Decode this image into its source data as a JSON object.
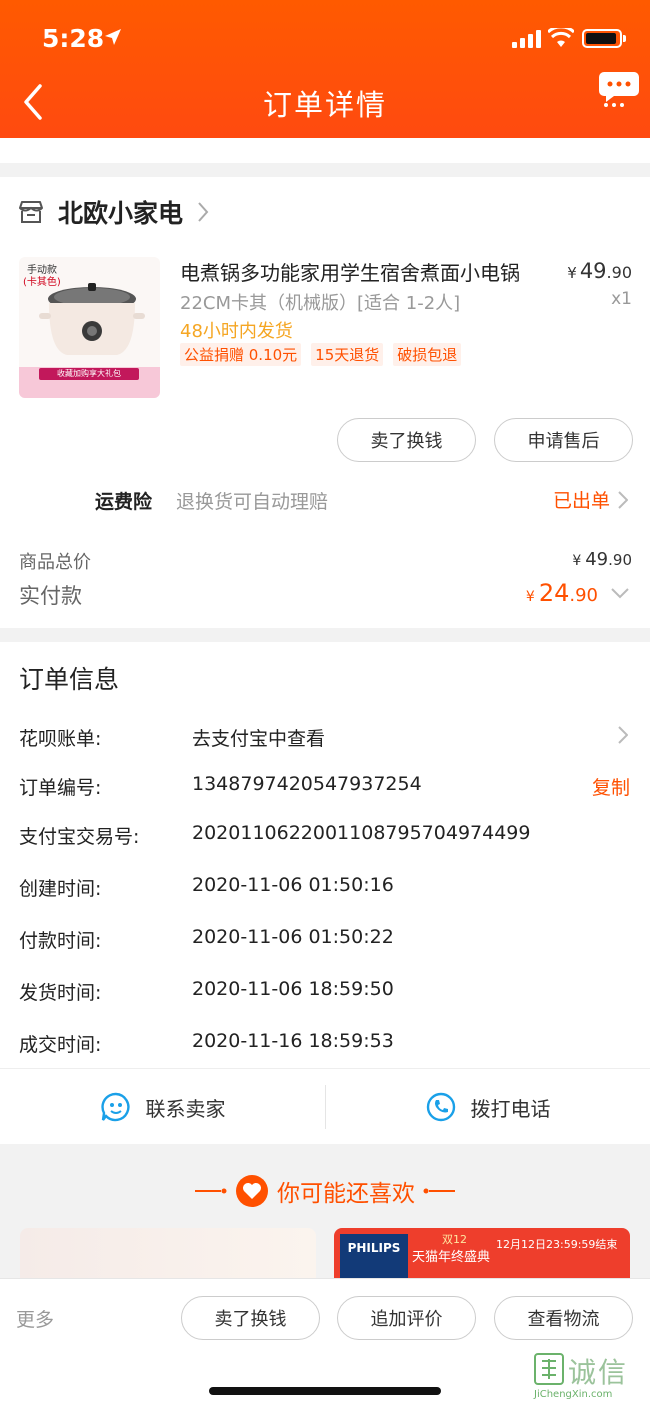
{
  "status_bar": {
    "time": "5:28"
  },
  "nav": {
    "title": "订单详情"
  },
  "store": {
    "name": "北欧小家电",
    "product": {
      "thumb_badge_line1": "手动款",
      "thumb_badge_line2": "(卡其色)",
      "thumb_banner": "收藏加购享大礼包",
      "title": "电煮锅多功能家用学生宿舍煮面小电锅",
      "sku": "22CM卡其（机械版）[适合 1-2人]",
      "shipping": "48小时内发货",
      "tags": [
        "公益捐赠 0.10元",
        "15天退货",
        "破损包退"
      ],
      "price_currency": "¥",
      "price_int": "49",
      "price_dec": ".90",
      "quantity": "x1"
    },
    "buttons": {
      "sell": "卖了换钱",
      "after_sale": "申请售后"
    },
    "insurance": {
      "label": "运费险",
      "desc": "退换货可自动理赔",
      "status": "已出单"
    },
    "total": {
      "label": "商品总价",
      "currency": "¥",
      "int": "49",
      "dec": ".90"
    },
    "paid": {
      "label": "实付款",
      "currency": "¥",
      "int": "24",
      "dec": ".90"
    }
  },
  "order_info": {
    "title": "订单信息",
    "rows": [
      {
        "label": "花呗账单:",
        "value": "去支付宝中查看"
      },
      {
        "label": "订单编号:",
        "value": "1348797420547937254",
        "action": "复制"
      },
      {
        "label": "支付宝交易号:",
        "value": "2020110622001108795704974499"
      },
      {
        "label": "创建时间:",
        "value": "2020-11-06 01:50:16"
      },
      {
        "label": "付款时间:",
        "value": "2020-11-06 01:50:22"
      },
      {
        "label": "发货时间:",
        "value": "2020-11-06 18:59:50"
      },
      {
        "label": "成交时间:",
        "value": "2020-11-16 18:59:53"
      }
    ]
  },
  "contact": {
    "seller": "联系卖家",
    "call": "拨打电话"
  },
  "recommend": {
    "title": "你可能还喜欢",
    "ad_brand": "PHILIPS",
    "ad_event_line1": "双12",
    "ad_event_line2": "天猫年终盛典",
    "ad_time": "12月12日23:59:59结束"
  },
  "bottom_bar": {
    "more": "更多",
    "sell": "卖了换钱",
    "review": "追加评价",
    "logistics": "查看物流"
  },
  "watermark": {
    "text": "诚信",
    "url": "JiChengXin.com"
  },
  "colors": {
    "accent": "#ff5000",
    "header": "#ff5a00",
    "shipping": "#f5a623"
  }
}
